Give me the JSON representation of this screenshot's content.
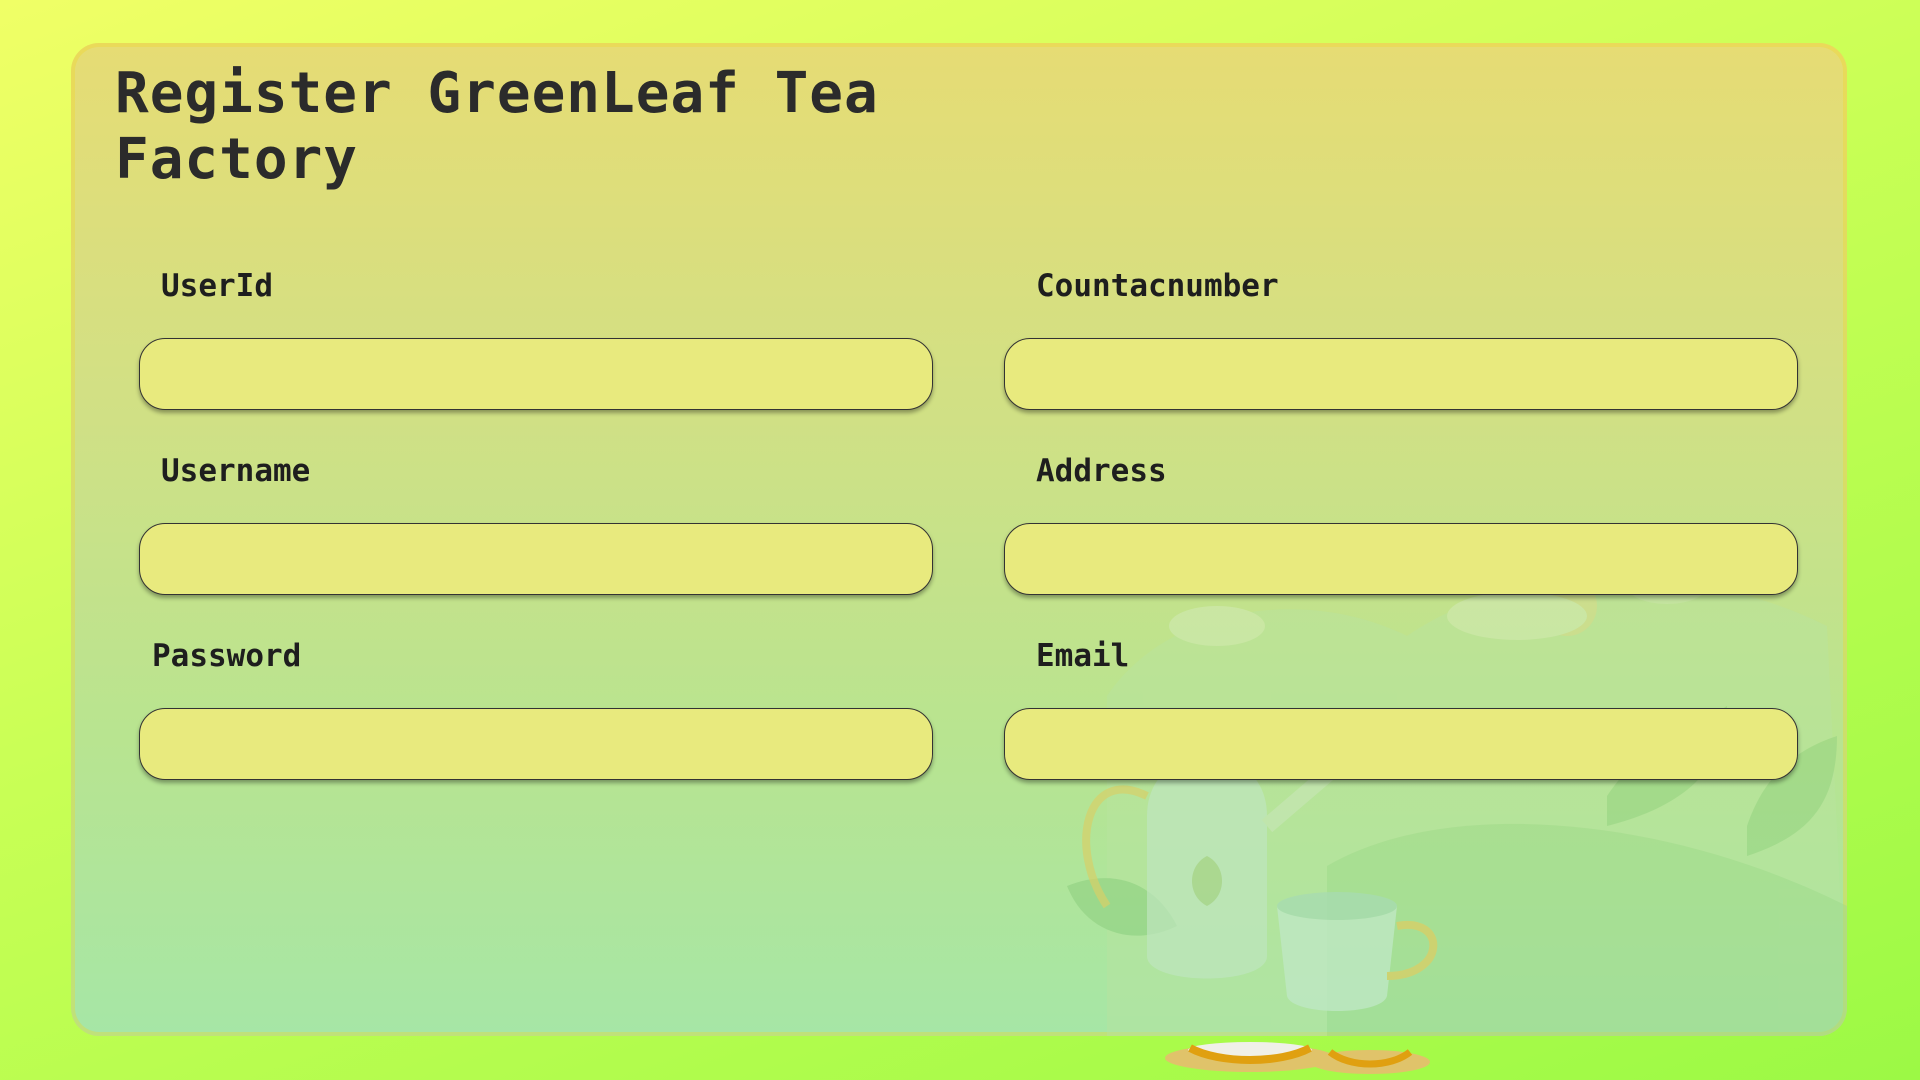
{
  "form": {
    "title": "Register GreenLeaf Tea Factory",
    "fields": {
      "userid": {
        "label": "UserId",
        "value": "",
        "placeholder": ""
      },
      "username": {
        "label": "Username",
        "value": "",
        "placeholder": ""
      },
      "password": {
        "label": "Password",
        "value": "",
        "placeholder": ""
      },
      "contactnumber": {
        "label": "Countacnumber",
        "value": "",
        "placeholder": ""
      },
      "address": {
        "label": "Address",
        "value": "",
        "placeholder": ""
      },
      "email": {
        "label": "Email",
        "value": "",
        "placeholder": ""
      }
    }
  },
  "colors": {
    "background": "#c8ff55",
    "panel_top": "#e6dc74",
    "panel_bottom": "#a6e6a6",
    "input_fill": "#e8ea7e",
    "text": "#2b2b2b"
  },
  "icons": [
    "teapot-illustration",
    "teacup-illustration",
    "tea-leaf-illustration"
  ]
}
